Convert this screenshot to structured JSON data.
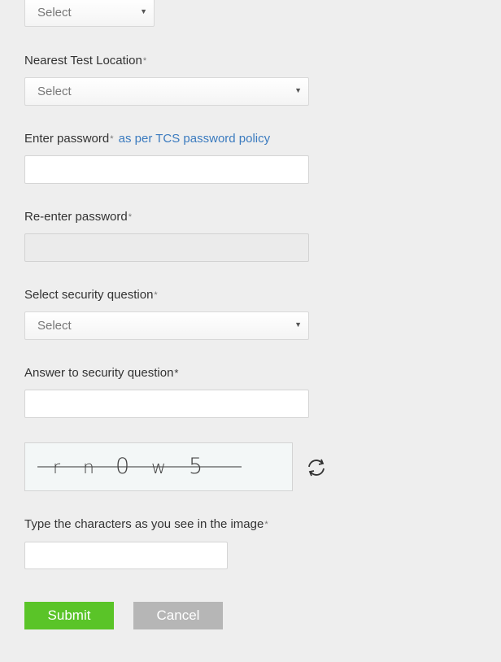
{
  "top_select": {
    "value": "Select"
  },
  "test_location": {
    "label": "Nearest Test Location",
    "required_mark": "*",
    "select_value": "Select"
  },
  "password": {
    "label": "Enter password",
    "required_mark": "*",
    "policy_link": "as per TCS password policy"
  },
  "reenter_password": {
    "label": "Re-enter password",
    "required_mark": "*"
  },
  "security_question": {
    "label": "Select security question",
    "required_mark": "*",
    "select_value": "Select"
  },
  "security_answer": {
    "label": "Answer to security question",
    "required_mark": "*"
  },
  "captcha": {
    "characters": [
      "r",
      "n",
      "0",
      "w",
      "5"
    ],
    "refresh_icon": "refresh-icon"
  },
  "captcha_input": {
    "label": "Type the characters as you see in the image",
    "required_mark": "*"
  },
  "buttons": {
    "submit": "Submit",
    "cancel": "Cancel"
  },
  "colors": {
    "background": "#eeeeee",
    "link": "#3b7bbf",
    "submit": "#5ac428",
    "cancel": "#b6b6b6"
  }
}
